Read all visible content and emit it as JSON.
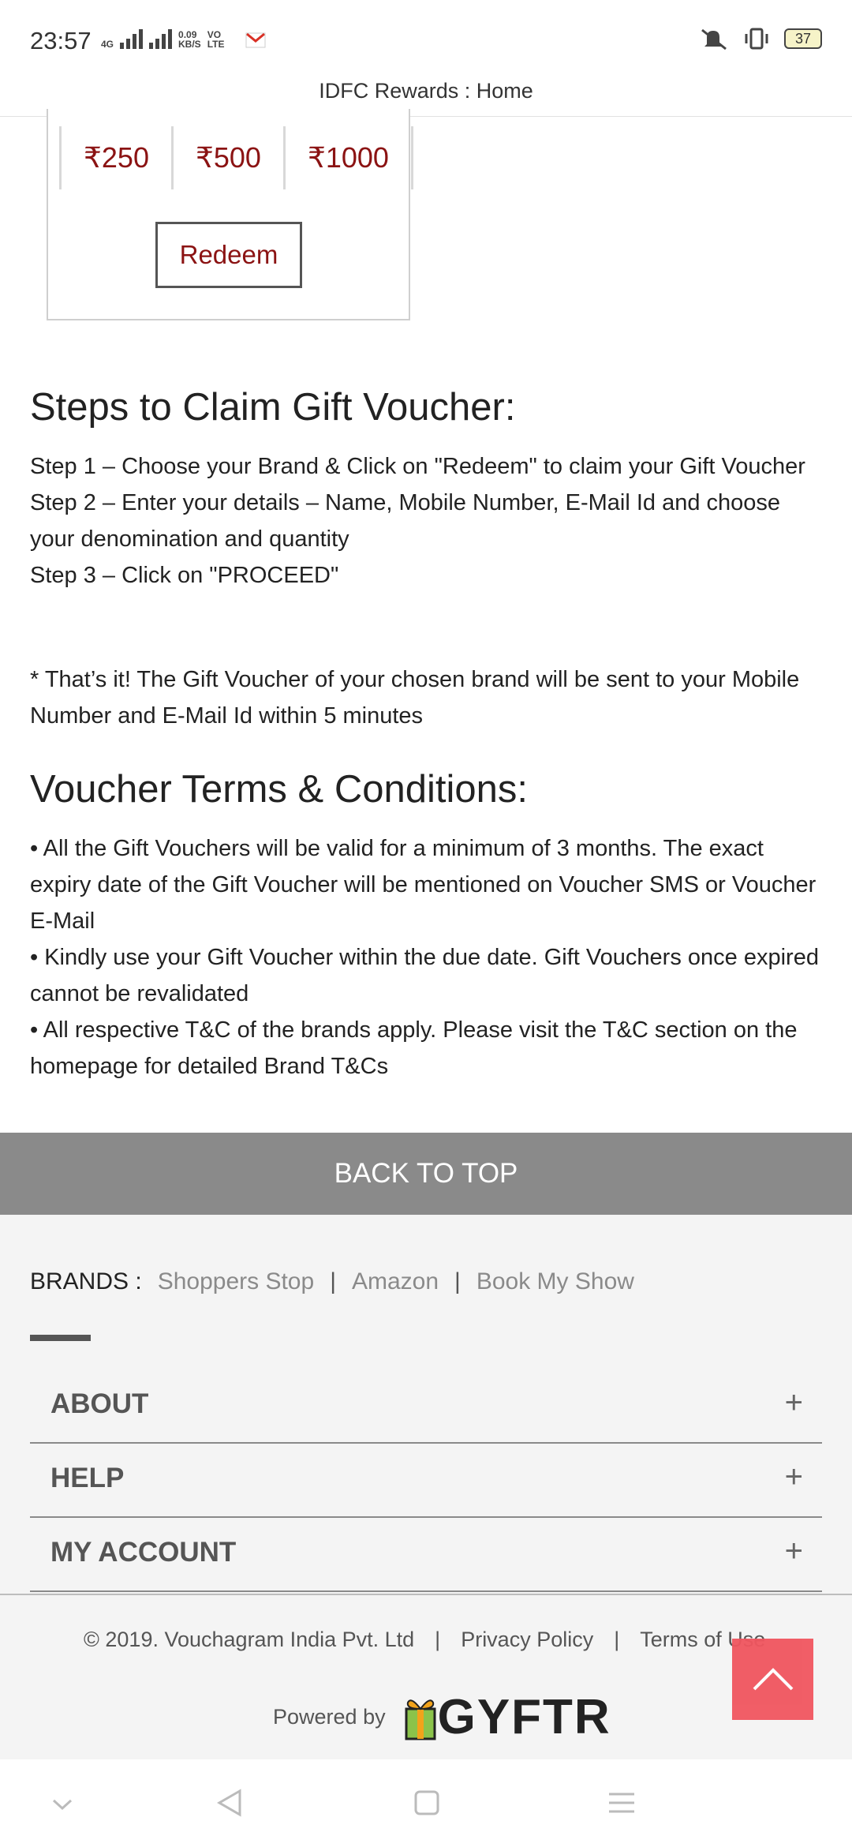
{
  "status_bar": {
    "time": "23:57",
    "net": "4G",
    "speed": "0.09",
    "speed_unit": "KB/S",
    "volte": "VO LTE",
    "battery": "37",
    "icons": [
      "signal-icon",
      "gmail-icon",
      "mute-icon",
      "vibrate-icon",
      "battery-icon"
    ]
  },
  "address_bar": {
    "title": "IDFC Rewards : Home"
  },
  "voucher_card": {
    "denominations": [
      "₹250",
      "₹500",
      "₹1000"
    ],
    "redeem_label": "Redeem"
  },
  "steps": {
    "heading": "Steps to Claim Gift Voucher:",
    "lines": [
      "Step 1 – Choose your Brand & Click on \"Redeem\" to claim your Gift Voucher",
      "Step 2 – Enter your details – Name, Mobile Number, E-Mail Id and choose your denomination and quantity",
      "Step 3 – Click on \"PROCEED\""
    ],
    "note": "* That’s it! The Gift Voucher of your chosen brand will be sent to your Mobile Number and E-Mail Id within 5 minutes"
  },
  "terms": {
    "heading": "Voucher Terms & Conditions:",
    "bullets": [
      "• All the Gift Vouchers will be valid for a minimum of 3 months. The exact expiry date of the Gift Voucher will be mentioned on Voucher SMS or Voucher E-Mail",
      "• Kindly use your Gift Voucher within the due date. Gift Vouchers once expired cannot be revalidated",
      "• All respective T&C of the brands apply. Please visit the T&C section on the homepage for detailed Brand T&Cs"
    ]
  },
  "back_to_top": "BACK TO TOP",
  "footer": {
    "brands_label": "BRANDS :",
    "brands": [
      "Shoppers Stop",
      "Amazon",
      "Book My Show"
    ],
    "sections": [
      "ABOUT",
      "HELP",
      "MY ACCOUNT"
    ],
    "copyright": "© 2019. Vouchagram India Pvt. Ltd",
    "privacy": "Privacy Policy",
    "terms_of_use": "Terms of Use",
    "powered_by": "Powered by",
    "logo_text": "GYFTR"
  },
  "accent_color": "#8b1313",
  "float_button_color": "#f0555f"
}
